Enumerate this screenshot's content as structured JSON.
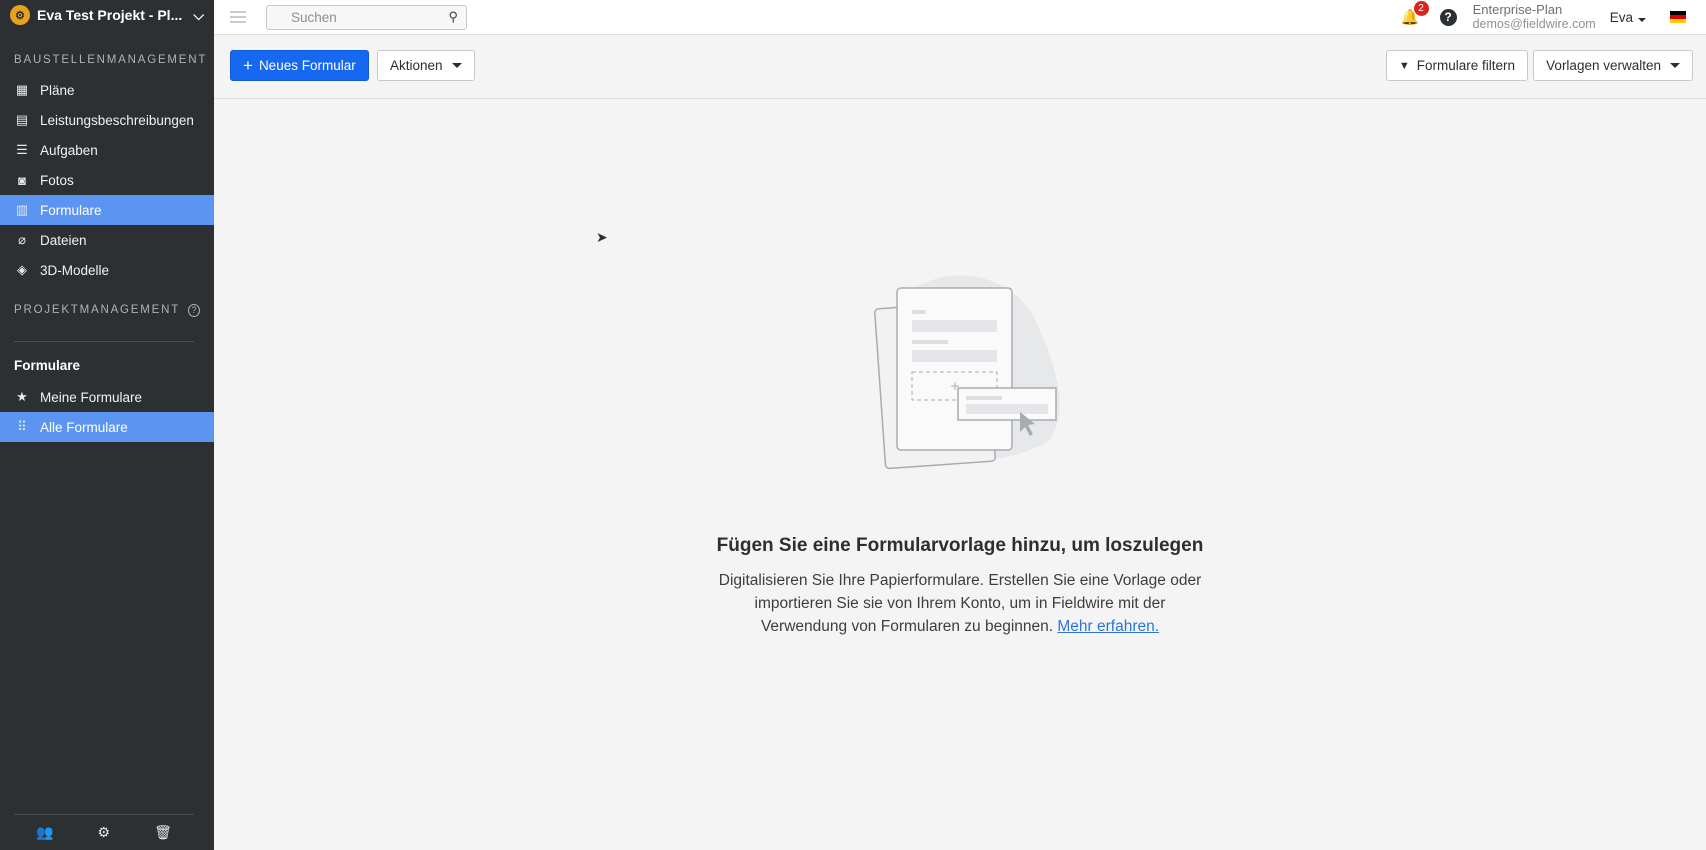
{
  "sidebar": {
    "project_title": "Eva Test Projekt - Pl...",
    "section1_heading": "BAUSTELLENMANAGEMENT",
    "items": [
      {
        "label": "Pläne",
        "icon": "plans-icon"
      },
      {
        "label": "Leistungsbeschreibungen",
        "icon": "specs-icon"
      },
      {
        "label": "Aufgaben",
        "icon": "tasks-icon"
      },
      {
        "label": "Fotos",
        "icon": "camera-icon"
      },
      {
        "label": "Formulare",
        "icon": "clipboard-icon"
      },
      {
        "label": "Dateien",
        "icon": "paperclip-icon"
      },
      {
        "label": "3D-Modelle",
        "icon": "cube-icon"
      }
    ],
    "section2_heading": "PROJEKTMANAGEMENT",
    "subsection_heading": "Formulare",
    "form_items": [
      {
        "label": "Meine Formulare",
        "icon": "star-icon"
      },
      {
        "label": "Alle Formulare",
        "icon": "grid-icon"
      }
    ]
  },
  "topbar": {
    "search_placeholder": "Suchen",
    "notification_count": "2",
    "plan_label": "Enterprise-Plan",
    "email": "demos@fieldwire.com",
    "user_name": "Eva"
  },
  "toolbar": {
    "new_form_label": "Neues Formular",
    "actions_label": "Aktionen",
    "filter_label": "Formulare filtern",
    "templates_label": "Vorlagen verwalten"
  },
  "empty_state": {
    "heading": "Fügen Sie eine Formularvorlage hinzu, um loszulegen",
    "body": "Digitalisieren Sie Ihre Papierformulare. Erstellen Sie eine Vorlage oder importieren Sie sie von Ihrem Konto, um in Fieldwire mit der Verwendung von Formularen zu beginnen.",
    "link": "Mehr erfahren."
  },
  "colors": {
    "sidebar_bg": "#2d3033",
    "active_bg": "#5c95f1",
    "primary": "#1668f0"
  }
}
